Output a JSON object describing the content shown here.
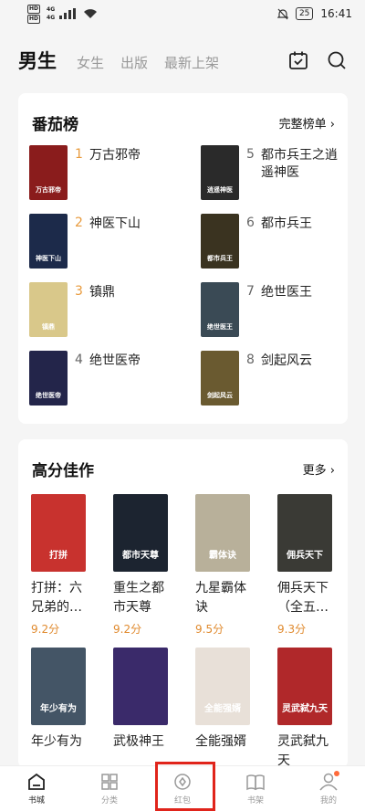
{
  "status_bar": {
    "hd1": "HD",
    "hd2": "HD",
    "net1": "4G",
    "net2": "4G",
    "battery": "25",
    "time": "16:41"
  },
  "header": {
    "tabs": [
      "男生",
      "女生",
      "出版",
      "最新上架"
    ]
  },
  "ranking": {
    "title": "番茄榜",
    "more": "完整榜单 ›",
    "items": [
      {
        "num": "1",
        "name": "万古邪帝",
        "cover_text": "万古邪帝",
        "color": "#8a1c1c"
      },
      {
        "num": "2",
        "name": "神医下山",
        "cover_text": "神医下山",
        "color": "#1c2a4a"
      },
      {
        "num": "3",
        "name": "镇鼎",
        "cover_text": "镇鼎",
        "color": "#d9c88a"
      },
      {
        "num": "4",
        "name": "绝世医帝",
        "cover_text": "绝世医帝",
        "color": "#23254a"
      },
      {
        "num": "5",
        "name": "都市兵王之逍遥神医",
        "cover_text": "逍遥神医",
        "color": "#2a2a2a"
      },
      {
        "num": "6",
        "name": "都市兵王",
        "cover_text": "都市兵王",
        "color": "#3a3320"
      },
      {
        "num": "7",
        "name": "绝世医王",
        "cover_text": "绝世医王",
        "color": "#3a4a55"
      },
      {
        "num": "8",
        "name": "剑起风云",
        "cover_text": "剑起风云",
        "color": "#6a5a30"
      }
    ]
  },
  "high_score": {
    "title": "高分佳作",
    "more": "更多 ›",
    "items": [
      {
        "title": "打拼：六兄弟的…",
        "score": "9.2分",
        "cover_text": "打拼",
        "color": "#c8322e"
      },
      {
        "title": "重生之都市天尊",
        "score": "9.2分",
        "cover_text": "都市天尊",
        "color": "#1c2430"
      },
      {
        "title": "九星霸体诀",
        "score": "9.5分",
        "cover_text": "霸体诀",
        "color": "#b8b09a"
      },
      {
        "title": "佣兵天下（全五…",
        "score": "9.3分",
        "cover_text": "佣兵天下",
        "color": "#3a3a35"
      },
      {
        "title": "年少有为",
        "score": "",
        "cover_text": "年少有为",
        "color": "#445566"
      },
      {
        "title": "武极神王",
        "score": "",
        "cover_text": "",
        "color": "#3a2a6a"
      },
      {
        "title": "全能强婿",
        "score": "",
        "cover_text": "全能强婿",
        "color": "#e8e0d8"
      },
      {
        "title": "灵武弑九天",
        "score": "",
        "cover_text": "灵武弑九天",
        "color": "#b0282a"
      }
    ]
  },
  "nav": [
    {
      "label": "书城",
      "icon": "home-icon"
    },
    {
      "label": "分类",
      "icon": "grid-icon"
    },
    {
      "label": "红包",
      "icon": "redpacket-icon"
    },
    {
      "label": "书架",
      "icon": "book-icon"
    },
    {
      "label": "我的",
      "icon": "user-icon"
    }
  ]
}
